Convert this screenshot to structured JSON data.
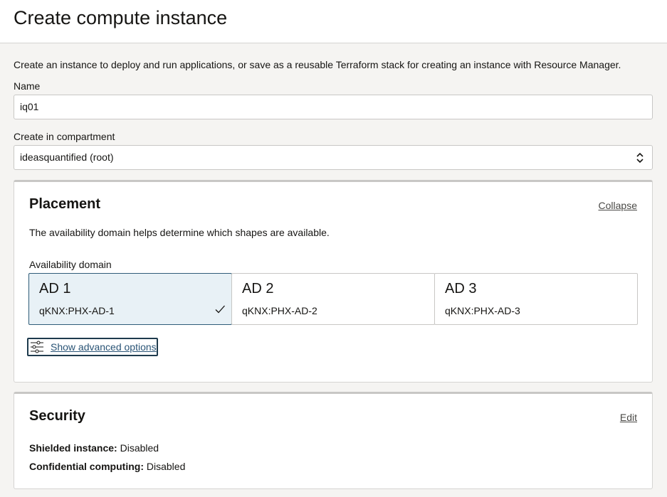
{
  "header": {
    "title": "Create compute instance"
  },
  "intro": "Create an instance to deploy and run applications, or save as a reusable Terraform stack for creating an instance with Resource Manager.",
  "name_field": {
    "label": "Name",
    "value": "iq01"
  },
  "compartment": {
    "label": "Create in compartment",
    "value": "ideasquantified (root)"
  },
  "placement": {
    "title": "Placement",
    "collapse_label": "Collapse",
    "description": "The availability domain helps determine which shapes are available.",
    "ad_label": "Availability domain",
    "domains": [
      {
        "name": "AD 1",
        "id": "qKNX:PHX-AD-1",
        "selected": true
      },
      {
        "name": "AD 2",
        "id": "qKNX:PHX-AD-2",
        "selected": false
      },
      {
        "name": "AD 3",
        "id": "qKNX:PHX-AD-3",
        "selected": false
      }
    ],
    "advanced_label": "Show advanced options"
  },
  "security": {
    "title": "Security",
    "edit_label": "Edit",
    "shielded_key": "Shielded instance:",
    "shielded_value": "Disabled",
    "confidential_key": "Confidential computing:",
    "confidential_value": "Disabled"
  },
  "icons": {
    "check": "check-icon",
    "sliders": "sliders-icon",
    "select_arrows": "select-arrows-icon"
  },
  "colors": {
    "selected_tile_bg": "#e8f1f6",
    "selected_tile_border": "#2f5c78",
    "link": "#2a5476"
  }
}
